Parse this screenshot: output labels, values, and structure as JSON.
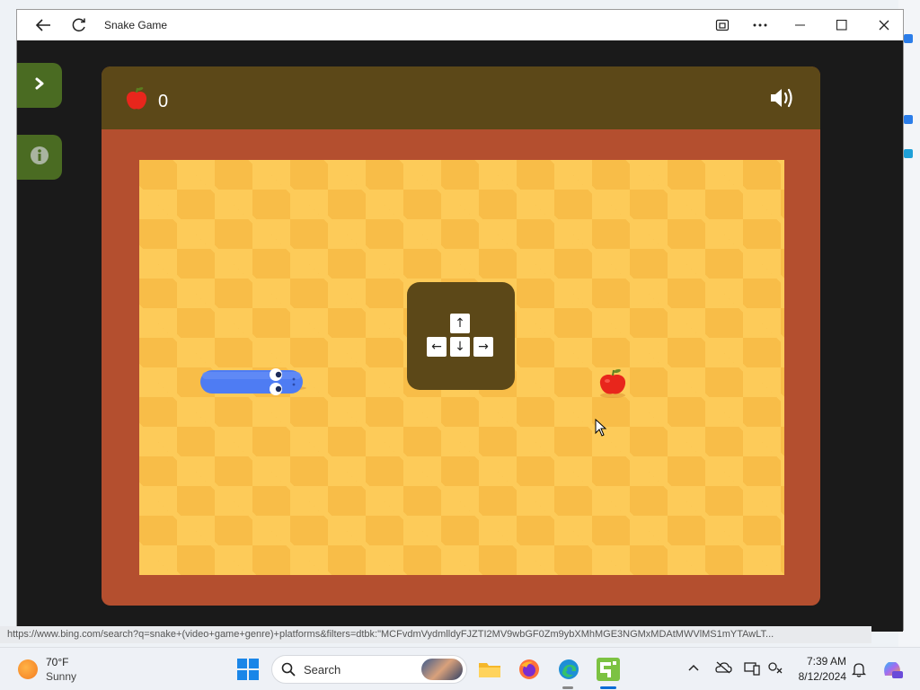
{
  "window": {
    "title": "Snake Game",
    "back_icon": "back-arrow-icon",
    "refresh_icon": "refresh-icon",
    "cast_icon": "app-cast-icon",
    "more_icon": "more-icon",
    "minimize_icon": "minimize-icon",
    "maximize_icon": "maximize-icon",
    "close_icon": "close-icon"
  },
  "game": {
    "score": "0",
    "score_icon": "apple-icon",
    "sound_icon": "speaker-icon",
    "menu_icon": "chevron-right-icon",
    "info_icon": "info-icon",
    "controls": {
      "up": "↑",
      "down": "↓",
      "left": "←",
      "right": "→"
    },
    "colors": {
      "header": "#5c4818",
      "border": "#b44f2f",
      "tile_light": "#fdcb59",
      "tile_dark": "#f8bd48",
      "snake": "#4e7cf3",
      "apple": "#e8261c",
      "side_button": "#4a6b22"
    }
  },
  "statusbar": {
    "url": "https://www.bing.com/search?q=snake+(video+game+genre)+platforms&filters=dtbk:\"MCFvdmVydmlldyFJZTI2MV9wbGF0Zm9ybXMhMGE3NGMxMDAtMWVlMS1mYTAwLT..."
  },
  "taskbar": {
    "weather": {
      "temp": "70°F",
      "condition": "Sunny"
    },
    "search_label": "Search",
    "apps": [
      "windows-start-icon",
      "file-explorer-icon",
      "firefox-icon",
      "edge-icon",
      "snake-game-app-icon"
    ],
    "clock": {
      "time": "7:39 AM",
      "date": "8/12/2024"
    },
    "tray": [
      "chevron-up-icon",
      "onedrive-icon",
      "display-icon",
      "accessibility-icon",
      "notification-icon",
      "copilot-icon"
    ]
  }
}
